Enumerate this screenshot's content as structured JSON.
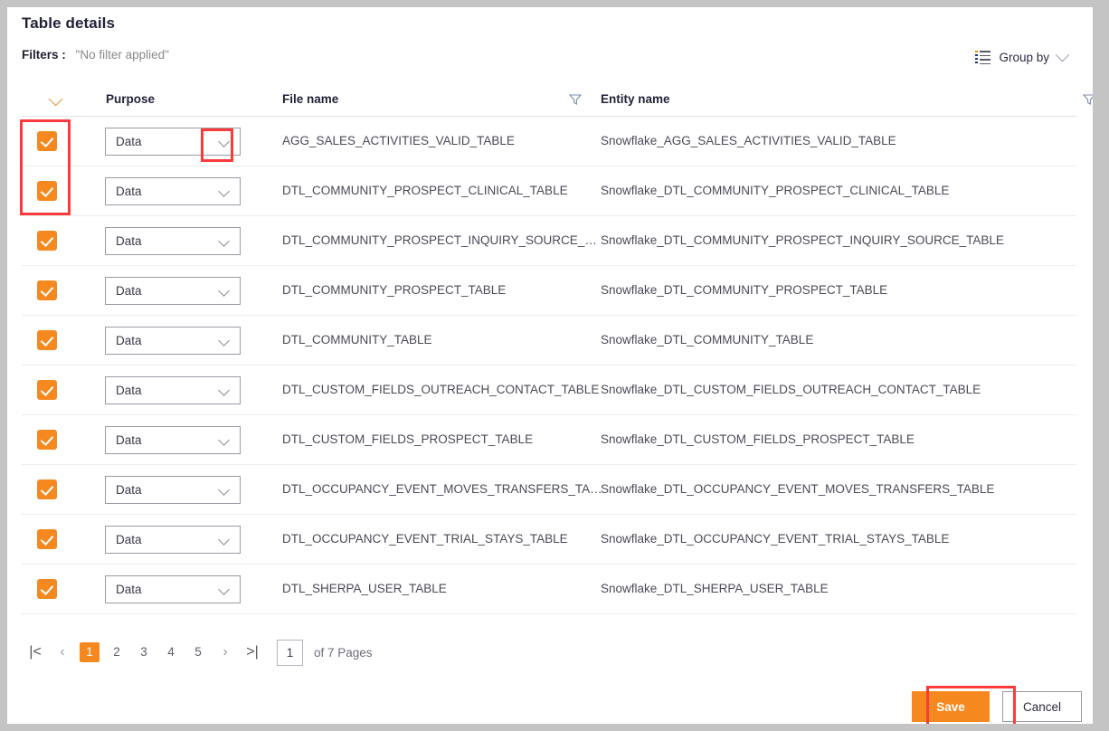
{
  "panel": {
    "title": "Table details",
    "filters_label": "Filters :",
    "filters_value": "\"No filter applied\"",
    "group_by_label": "Group by"
  },
  "columns": {
    "purpose": "Purpose",
    "file_name": "File name",
    "entity_name": "Entity name"
  },
  "rows": [
    {
      "checked": true,
      "purpose": "Data",
      "file_name": "AGG_SALES_ACTIVITIES_VALID_TABLE",
      "entity_name": "Snowflake_AGG_SALES_ACTIVITIES_VALID_TABLE"
    },
    {
      "checked": true,
      "purpose": "Data",
      "file_name": "DTL_COMMUNITY_PROSPECT_CLINICAL_TABLE",
      "entity_name": "Snowflake_DTL_COMMUNITY_PROSPECT_CLINICAL_TABLE"
    },
    {
      "checked": true,
      "purpose": "Data",
      "file_name": "DTL_COMMUNITY_PROSPECT_INQUIRY_SOURCE_…",
      "entity_name": "Snowflake_DTL_COMMUNITY_PROSPECT_INQUIRY_SOURCE_TABLE"
    },
    {
      "checked": true,
      "purpose": "Data",
      "file_name": "DTL_COMMUNITY_PROSPECT_TABLE",
      "entity_name": "Snowflake_DTL_COMMUNITY_PROSPECT_TABLE"
    },
    {
      "checked": true,
      "purpose": "Data",
      "file_name": "DTL_COMMUNITY_TABLE",
      "entity_name": "Snowflake_DTL_COMMUNITY_TABLE"
    },
    {
      "checked": true,
      "purpose": "Data",
      "file_name": "DTL_CUSTOM_FIELDS_OUTREACH_CONTACT_TABLE",
      "entity_name": "Snowflake_DTL_CUSTOM_FIELDS_OUTREACH_CONTACT_TABLE"
    },
    {
      "checked": true,
      "purpose": "Data",
      "file_name": "DTL_CUSTOM_FIELDS_PROSPECT_TABLE",
      "entity_name": "Snowflake_DTL_CUSTOM_FIELDS_PROSPECT_TABLE"
    },
    {
      "checked": true,
      "purpose": "Data",
      "file_name": "DTL_OCCUPANCY_EVENT_MOVES_TRANSFERS_TA…",
      "entity_name": "Snowflake_DTL_OCCUPANCY_EVENT_MOVES_TRANSFERS_TABLE"
    },
    {
      "checked": true,
      "purpose": "Data",
      "file_name": "DTL_OCCUPANCY_EVENT_TRIAL_STAYS_TABLE",
      "entity_name": "Snowflake_DTL_OCCUPANCY_EVENT_TRIAL_STAYS_TABLE"
    },
    {
      "checked": true,
      "purpose": "Data",
      "file_name": "DTL_SHERPA_USER_TABLE",
      "entity_name": "Snowflake_DTL_SHERPA_USER_TABLE"
    }
  ],
  "pagination": {
    "first_label": "|<",
    "prev_label": "‹",
    "next_label": "›",
    "last_label": ">|",
    "pages": [
      "1",
      "2",
      "3",
      "4",
      "5"
    ],
    "current_page": "1",
    "page_input_value": "1",
    "total_label": "of 7 Pages"
  },
  "footer": {
    "save_label": "Save",
    "cancel_label": "Cancel"
  },
  "colors": {
    "accent_orange": "#f5891f",
    "highlight_red": "#fb3b3b",
    "page_chrome_gray": "#c4c4c4"
  }
}
